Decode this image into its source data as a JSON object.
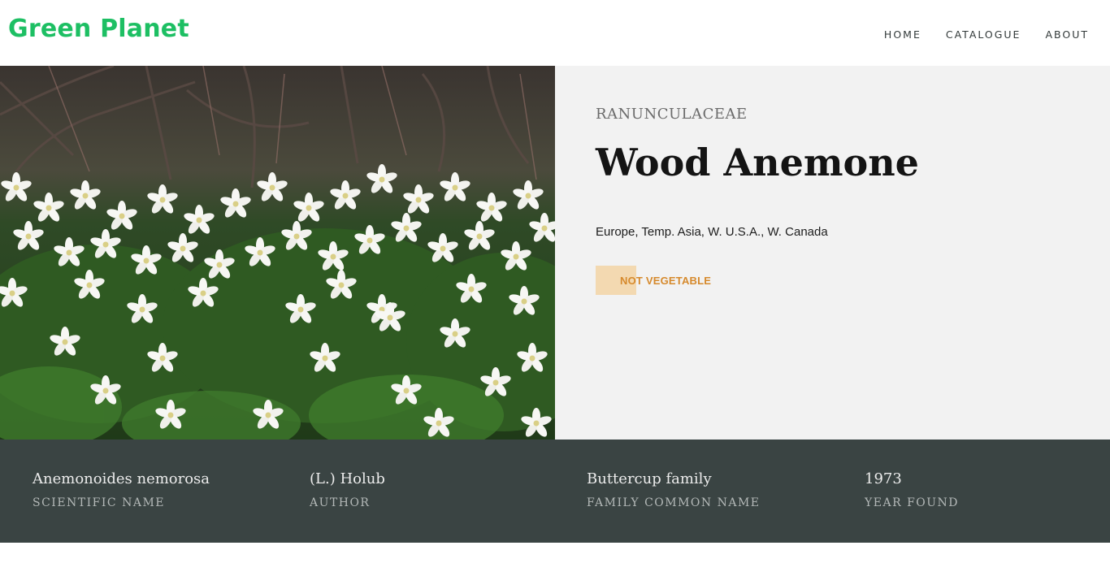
{
  "brand": "Green Planet",
  "nav": {
    "home": "HOME",
    "catalogue": "CATALOGUE",
    "about": "ABOUT"
  },
  "plant": {
    "family": "RANUNCULACEAE",
    "name": "Wood Anemone",
    "distribution": "Europe, Temp. Asia, W. U.S.A., W. Canada",
    "vegetable_status": "NOT VEGETABLE"
  },
  "facts": [
    {
      "value": "Anemonoides nemorosa",
      "caption": "SCIENTIFIC NAME"
    },
    {
      "value": "(L.) Holub",
      "caption": "AUTHOR"
    },
    {
      "value": "Buttercup family",
      "caption": "FAMILY COMMON NAME"
    },
    {
      "value": "1973",
      "caption": "YEAR FOUND"
    }
  ],
  "colors": {
    "brand": "#1dbf63",
    "info_panel": "#f2f2f2",
    "facts_bar": "#3a4443",
    "badge_bg": "#f3d9b1",
    "badge_text": "#d68a2d"
  }
}
